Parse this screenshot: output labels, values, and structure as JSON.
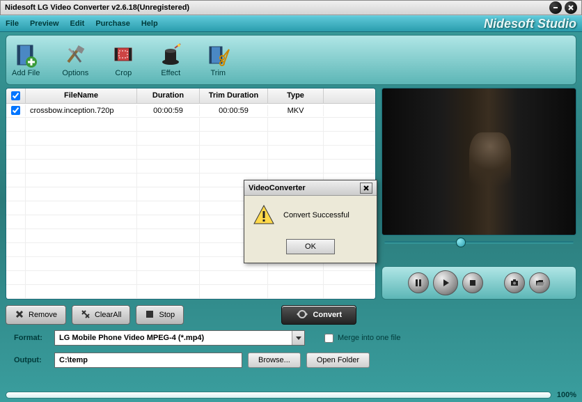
{
  "window": {
    "title": "Nidesoft LG Video Converter v2.6.18(Unregistered)"
  },
  "menu": {
    "file": "File",
    "preview": "Preview",
    "edit": "Edit",
    "purchase": "Purchase",
    "help": "Help"
  },
  "brand": "Nidesoft Studio",
  "toolbar": {
    "addFile": "Add File",
    "options": "Options",
    "crop": "Crop",
    "effect": "Effect",
    "trim": "Trim"
  },
  "table": {
    "headers": {
      "filename": "FileName",
      "duration": "Duration",
      "trimDuration": "Trim Duration",
      "type": "Type"
    },
    "rows": [
      {
        "checked": true,
        "filename": "crossbow.inception.720p",
        "duration": "00:00:59",
        "trimDuration": "00:00:59",
        "type": "MKV"
      }
    ]
  },
  "actions": {
    "remove": "Remove",
    "clearAll": "ClearAll",
    "stop": "Stop",
    "convert": "Convert"
  },
  "form": {
    "formatLabel": "Format:",
    "formatValue": "LG Mobile Phone Video MPEG-4 (*.mp4)",
    "outputLabel": "Output:",
    "outputValue": "C:\\temp",
    "browse": "Browse...",
    "openFolder": "Open Folder",
    "mergeLabel": "Merge into one file",
    "mergeChecked": false
  },
  "progress": {
    "percent": "100%"
  },
  "dialog": {
    "title": "VideoConverter",
    "message": "Convert Successful",
    "ok": "OK"
  }
}
